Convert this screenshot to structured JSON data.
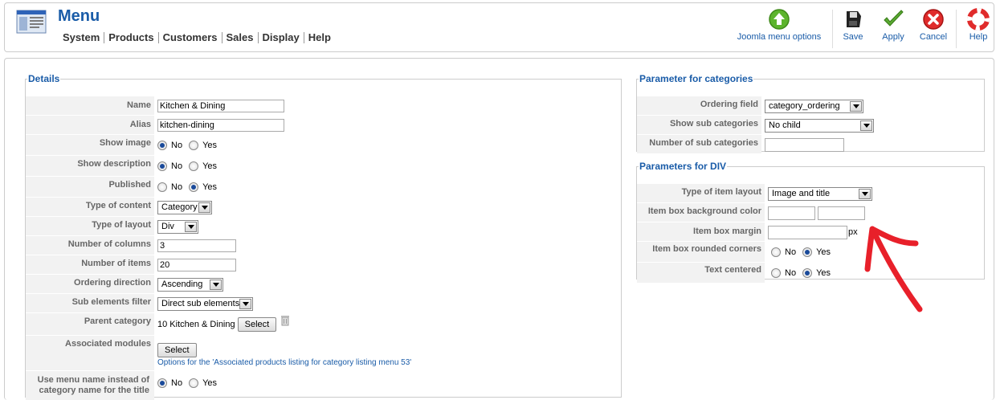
{
  "app": {
    "title": "Menu"
  },
  "menubar": [
    "System",
    "Products",
    "Customers",
    "Sales",
    "Display",
    "Help"
  ],
  "toolbar": {
    "menu_options": "Joomla menu options",
    "save": "Save",
    "apply": "Apply",
    "cancel": "Cancel",
    "help": "Help"
  },
  "details": {
    "legend": "Details",
    "name_label": "Name",
    "name_value": "Kitchen & Dining",
    "alias_label": "Alias",
    "alias_value": "kitchen-dining",
    "show_image_label": "Show image",
    "show_description_label": "Show description",
    "published_label": "Published",
    "type_content_label": "Type of content",
    "type_content_value": "Category",
    "type_layout_label": "Type of layout",
    "type_layout_value": "Div",
    "num_columns_label": "Number of columns",
    "num_columns_value": "3",
    "num_items_label": "Number of items",
    "num_items_value": "20",
    "ordering_label": "Ordering direction",
    "ordering_value": "Ascending",
    "sub_filter_label": "Sub elements filter",
    "sub_filter_value": "Direct sub elements",
    "parent_label": "Parent category",
    "parent_value": "10 Kitchen & Dining",
    "assoc_label": "Associated modules",
    "assoc_link": "Options for the 'Associated products listing for category listing menu 53'",
    "use_menu_name_label_1": "Use menu name instead of",
    "use_menu_name_label_2": "category name for the title",
    "select_button": "Select",
    "no": "No",
    "yes": "Yes"
  },
  "categories": {
    "legend": "Parameter for categories",
    "ordering_field_label": "Ordering field",
    "ordering_field_value": "category_ordering",
    "show_sub_label": "Show sub categories",
    "show_sub_value": "No child",
    "num_sub_label": "Number of sub categories",
    "num_sub_value": ""
  },
  "div": {
    "legend": "Parameters for DIV",
    "item_layout_label": "Type of item layout",
    "item_layout_value": "Image and title",
    "bg_color_label": "Item box background color",
    "margin_label": "Item box margin",
    "margin_unit": "px",
    "rounded_label": "Item box rounded corners",
    "centered_label": "Text centered"
  },
  "colors": {
    "accent": "#1a5ca8",
    "annotation_arrow": "#e8202a"
  }
}
